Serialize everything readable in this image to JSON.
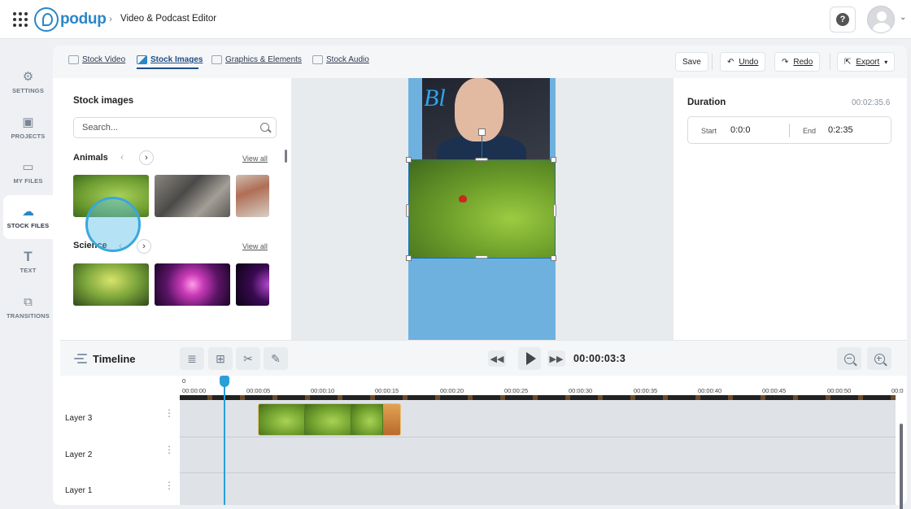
{
  "header": {
    "logo_text": "podup",
    "breadcrumb_separator": "›",
    "breadcrumb": "Video & Podcast Editor",
    "help_label": "?",
    "avatar_caret": "⌄"
  },
  "sidebar": {
    "items": [
      {
        "label": "SETTINGS",
        "icon": "gear-icon"
      },
      {
        "label": "PROJECTS",
        "icon": "projects-icon"
      },
      {
        "label": "MY FILES",
        "icon": "my-files-icon"
      },
      {
        "label": "STOCK FILES",
        "icon": "cloud-icon",
        "active": true
      },
      {
        "label": "TEXT",
        "icon": "text-icon"
      },
      {
        "label": "TRANSITIONS",
        "icon": "transitions-icon"
      }
    ]
  },
  "tabs": [
    {
      "label": "Stock Video"
    },
    {
      "label": "Stock Images",
      "active": true
    },
    {
      "label": "Graphics & Elements"
    },
    {
      "label": "Stock Audio"
    }
  ],
  "toolbar": {
    "save_label": "Save",
    "undo_label": "Undo",
    "redo_label": "Redo",
    "export_label": "Export",
    "export_caret": "▾"
  },
  "stock_panel": {
    "title": "Stock images",
    "search_placeholder": "Search...",
    "categories": [
      {
        "name": "Animals",
        "view_all": "View all"
      },
      {
        "name": "Science",
        "view_all": "View all"
      }
    ],
    "nav_prev": "‹",
    "nav_next": "›"
  },
  "duration": {
    "title": "Duration",
    "total": "00:02:35.6",
    "start_label": "Start",
    "start_value": "0:0:0",
    "end_label": "End",
    "end_value": "0:2:35"
  },
  "timeline": {
    "title": "Timeline",
    "timecode": "00:00:03:3",
    "zero_label": "0",
    "ticks": [
      "00:00:00",
      "00:00:05",
      "00:00:10",
      "00:00:15",
      "00:00:20",
      "00:00:25",
      "00:00:30",
      "00:00:35",
      "00:00:40",
      "00:00:45",
      "00:00:50",
      "00:0"
    ],
    "layers": [
      "Layer 3",
      "Layer 2",
      "Layer 1"
    ],
    "layer_menu": "⋮",
    "rewind": "◀◀",
    "forward": "▶▶"
  },
  "colors": {
    "brand": "#2a86c8",
    "canvas": "#6fb1de",
    "playhead": "#2a9ed8"
  }
}
